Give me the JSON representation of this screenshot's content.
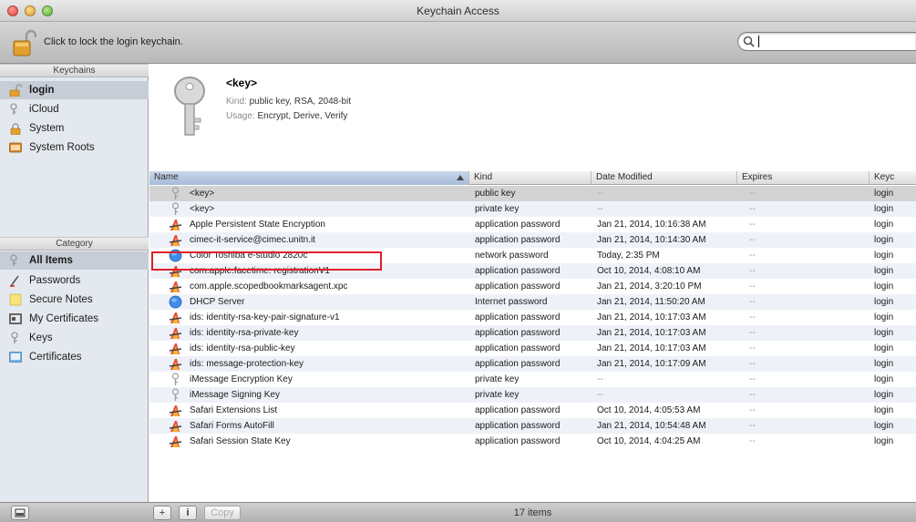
{
  "window": {
    "title": "Keychain Access"
  },
  "toolbar": {
    "lock_text": "Click to lock the login keychain.",
    "search_value": "",
    "search_placeholder": ""
  },
  "sidebar": {
    "keychains_header": "Keychains",
    "keychains": [
      {
        "label": "login",
        "icon": "login-keychain-icon",
        "selected": true
      },
      {
        "label": "iCloud",
        "icon": "icloud-keychain-icon",
        "selected": false
      },
      {
        "label": "System",
        "icon": "system-keychain-icon",
        "selected": false
      },
      {
        "label": "System Roots",
        "icon": "system-roots-icon",
        "selected": false
      }
    ],
    "category_header": "Category",
    "categories": [
      {
        "label": "All Items",
        "icon": "all-items-icon",
        "selected": true
      },
      {
        "label": "Passwords",
        "icon": "passwords-icon",
        "selected": false
      },
      {
        "label": "Secure Notes",
        "icon": "secure-notes-icon",
        "selected": false
      },
      {
        "label": "My Certificates",
        "icon": "my-certificates-icon",
        "selected": false
      },
      {
        "label": "Keys",
        "icon": "keys-icon",
        "selected": false
      },
      {
        "label": "Certificates",
        "icon": "certificates-icon",
        "selected": false
      }
    ]
  },
  "info": {
    "name": "<key>",
    "kind_label": "Kind:",
    "kind_value": "public key, RSA, 2048-bit",
    "usage_label": "Usage:",
    "usage_value": "Encrypt, Derive, Verify"
  },
  "table": {
    "columns": [
      "Name",
      "Kind",
      "Date Modified",
      "Expires",
      "Keyc"
    ],
    "sorted_column": "Name",
    "rows": [
      {
        "icon": "key-icon",
        "name": "<key>",
        "kind": "public key",
        "date": "--",
        "expires": "--",
        "keychain": "login",
        "selected": true
      },
      {
        "icon": "key-icon",
        "name": "<key>",
        "kind": "private key",
        "date": "--",
        "expires": "--",
        "keychain": "login"
      },
      {
        "icon": "password-icon",
        "name": "Apple Persistent State Encryption",
        "kind": "application password",
        "date": "Jan 21, 2014, 10:16:38 AM",
        "expires": "--",
        "keychain": "login"
      },
      {
        "icon": "password-icon",
        "name": "cimec-it-service@cimec.unitn.it",
        "kind": "application password",
        "date": "Jan 21, 2014, 10:14:30 AM",
        "expires": "--",
        "keychain": "login"
      },
      {
        "icon": "network-icon",
        "name": "Color Toshiba e-studio 2820c",
        "kind": "network password",
        "date": "Today, 2:35 PM",
        "expires": "--",
        "keychain": "login",
        "highlighted": true
      },
      {
        "icon": "password-icon",
        "name": "com.apple.facetime: registrationV1",
        "kind": "application password",
        "date": "Oct 10, 2014, 4:08:10 AM",
        "expires": "--",
        "keychain": "login"
      },
      {
        "icon": "password-icon",
        "name": "com.apple.scopedbookmarksagent.xpc",
        "kind": "application password",
        "date": "Jan 21, 2014, 3:20:10 PM",
        "expires": "--",
        "keychain": "login"
      },
      {
        "icon": "network-icon",
        "name": "DHCP Server",
        "kind": "Internet password",
        "date": "Jan 21, 2014, 11:50:20 AM",
        "expires": "--",
        "keychain": "login"
      },
      {
        "icon": "password-icon",
        "name": "ids: identity-rsa-key-pair-signature-v1",
        "kind": "application password",
        "date": "Jan 21, 2014, 10:17:03 AM",
        "expires": "--",
        "keychain": "login"
      },
      {
        "icon": "password-icon",
        "name": "ids: identity-rsa-private-key",
        "kind": "application password",
        "date": "Jan 21, 2014, 10:17:03 AM",
        "expires": "--",
        "keychain": "login"
      },
      {
        "icon": "password-icon",
        "name": "ids: identity-rsa-public-key",
        "kind": "application password",
        "date": "Jan 21, 2014, 10:17:03 AM",
        "expires": "--",
        "keychain": "login"
      },
      {
        "icon": "password-icon",
        "name": "ids: message-protection-key",
        "kind": "application password",
        "date": "Jan 21, 2014, 10:17:09 AM",
        "expires": "--",
        "keychain": "login"
      },
      {
        "icon": "key-icon",
        "name": "iMessage Encryption Key",
        "kind": "private key",
        "date": "--",
        "expires": "--",
        "keychain": "login"
      },
      {
        "icon": "key-icon",
        "name": "iMessage Signing Key",
        "kind": "private key",
        "date": "--",
        "expires": "--",
        "keychain": "login"
      },
      {
        "icon": "password-icon",
        "name": "Safari Extensions List",
        "kind": "application password",
        "date": "Oct 10, 2014, 4:05:53 AM",
        "expires": "--",
        "keychain": "login"
      },
      {
        "icon": "password-icon",
        "name": "Safari Forms AutoFill",
        "kind": "application password",
        "date": "Jan 21, 2014, 10:54:48 AM",
        "expires": "--",
        "keychain": "login"
      },
      {
        "icon": "password-icon",
        "name": "Safari Session State Key",
        "kind": "application password",
        "date": "Oct 10, 2014, 4:04:25 AM",
        "expires": "--",
        "keychain": "login"
      }
    ]
  },
  "bottom": {
    "add_label": "+",
    "info_label": "i",
    "copy_label": "Copy",
    "item_count": "17 items"
  },
  "colors": {
    "highlight_border": "#e0202a",
    "selection": "#d3d3d3",
    "sidebar_bg": "#e4e9ef"
  }
}
